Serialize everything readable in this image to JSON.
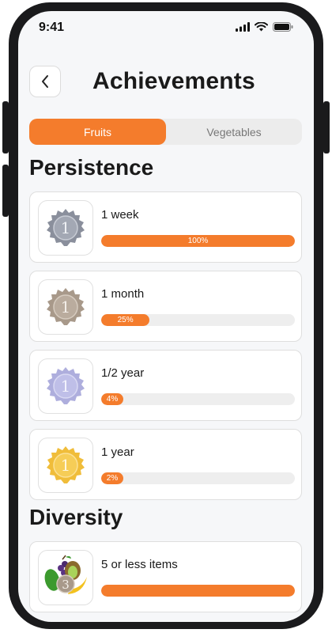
{
  "status_bar": {
    "time": "9:41"
  },
  "header": {
    "title": "Achievements"
  },
  "tabs": [
    {
      "label": "Fruits",
      "active": true
    },
    {
      "label": "Vegetables",
      "active": false
    }
  ],
  "sections": [
    {
      "title": "Persistence",
      "items": [
        {
          "label": "1 week",
          "progress": 100,
          "progress_label": "100%",
          "medal": "silver-medal-icon",
          "medal_number": "1",
          "medal_color": "#8a8f9c"
        },
        {
          "label": "1 month",
          "progress": 25,
          "progress_label": "25%",
          "medal": "bronze-medal-icon",
          "medal_number": "1",
          "medal_color": "#a8998a"
        },
        {
          "label": "1/2 year",
          "progress": 4,
          "progress_label": "4%",
          "medal": "lavender-medal-icon",
          "medal_number": "1",
          "medal_color": "#aeaedd"
        },
        {
          "label": "1 year",
          "progress": 2,
          "progress_label": "2%",
          "medal": "gold-medal-icon",
          "medal_number": "1",
          "medal_color": "#f0bd3a"
        }
      ]
    },
    {
      "title": "Diversity",
      "items": [
        {
          "label": "5 or less items",
          "progress": 100,
          "progress_label": "",
          "medal": "fruit-medal-icon",
          "medal_number": "3",
          "medal_color": "#a8998a"
        }
      ]
    }
  ],
  "colors": {
    "accent": "#f47c2c",
    "track": "#eeeeee"
  }
}
